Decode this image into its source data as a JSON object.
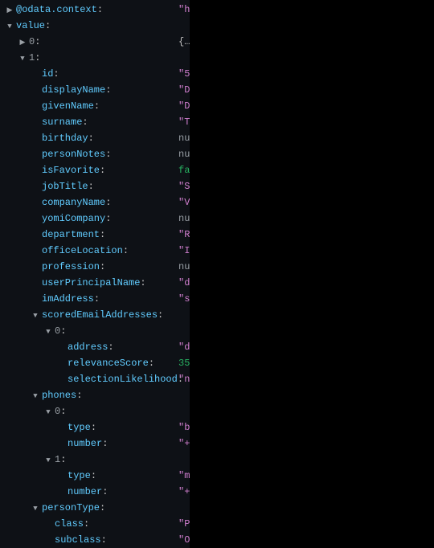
{
  "rows": [
    {
      "indent": 0,
      "twist": "right",
      "key": "@odata.context",
      "keyStyle": "key",
      "valText": "\"h",
      "valStyle": "val-string"
    },
    {
      "indent": 0,
      "twist": "down",
      "key": "value",
      "keyStyle": "key",
      "valText": "",
      "valStyle": ""
    },
    {
      "indent": 1,
      "twist": "right",
      "key": "0",
      "keyStyle": "key-gray",
      "valText": "{…",
      "valStyle": "val-obj"
    },
    {
      "indent": 1,
      "twist": "down",
      "key": "1",
      "keyStyle": "key-gray",
      "valText": "",
      "valStyle": ""
    },
    {
      "indent": 2,
      "twist": "",
      "key": "id",
      "keyStyle": "key",
      "valText": "\"5",
      "valStyle": "val-string"
    },
    {
      "indent": 2,
      "twist": "",
      "key": "displayName",
      "keyStyle": "key",
      "valText": "\"D",
      "valStyle": "val-string"
    },
    {
      "indent": 2,
      "twist": "",
      "key": "givenName",
      "keyStyle": "key",
      "valText": "\"D",
      "valStyle": "val-string"
    },
    {
      "indent": 2,
      "twist": "",
      "key": "surname",
      "keyStyle": "key",
      "valText": "\"T",
      "valStyle": "val-string"
    },
    {
      "indent": 2,
      "twist": "",
      "key": "birthday",
      "keyStyle": "key",
      "valText": "nu",
      "valStyle": "val-null"
    },
    {
      "indent": 2,
      "twist": "",
      "key": "personNotes",
      "keyStyle": "key",
      "valText": "nu",
      "valStyle": "val-null"
    },
    {
      "indent": 2,
      "twist": "",
      "key": "isFavorite",
      "keyStyle": "key",
      "valText": "fa",
      "valStyle": "val-false"
    },
    {
      "indent": 2,
      "twist": "",
      "key": "jobTitle",
      "keyStyle": "key",
      "valText": "\"S",
      "valStyle": "val-string"
    },
    {
      "indent": 2,
      "twist": "",
      "key": "companyName",
      "keyStyle": "key",
      "valText": "\"V",
      "valStyle": "val-string"
    },
    {
      "indent": 2,
      "twist": "",
      "key": "yomiCompany",
      "keyStyle": "key",
      "valText": "nu",
      "valStyle": "val-null"
    },
    {
      "indent": 2,
      "twist": "",
      "key": "department",
      "keyStyle": "key",
      "valText": "\"R",
      "valStyle": "val-string"
    },
    {
      "indent": 2,
      "twist": "",
      "key": "officeLocation",
      "keyStyle": "key",
      "valText": "\"I",
      "valStyle": "val-string"
    },
    {
      "indent": 2,
      "twist": "",
      "key": "profession",
      "keyStyle": "key",
      "valText": "nu",
      "valStyle": "val-null"
    },
    {
      "indent": 2,
      "twist": "",
      "key": "userPrincipalName",
      "keyStyle": "key",
      "valText": "\"d",
      "valStyle": "val-string"
    },
    {
      "indent": 2,
      "twist": "",
      "key": "imAddress",
      "keyStyle": "key",
      "valText": "\"s",
      "valStyle": "val-string"
    },
    {
      "indent": 2,
      "twist": "down",
      "key": "scoredEmailAddresses",
      "keyStyle": "key",
      "valText": "",
      "valStyle": ""
    },
    {
      "indent": 3,
      "twist": "down",
      "key": "0",
      "keyStyle": "key-gray",
      "valText": "",
      "valStyle": ""
    },
    {
      "indent": 4,
      "twist": "",
      "key": "address",
      "keyStyle": "key",
      "valText": "\"d",
      "valStyle": "val-string"
    },
    {
      "indent": 4,
      "twist": "",
      "key": "relevanceScore",
      "keyStyle": "key",
      "valText": "35",
      "valStyle": "val-num"
    },
    {
      "indent": 4,
      "twist": "",
      "key": "selectionLikelihood",
      "keyStyle": "key",
      "valText": "\"n",
      "valStyle": "val-string"
    },
    {
      "indent": 2,
      "twist": "down",
      "key": "phones",
      "keyStyle": "key",
      "valText": "",
      "valStyle": ""
    },
    {
      "indent": 3,
      "twist": "down",
      "key": "0",
      "keyStyle": "key-gray",
      "valText": "",
      "valStyle": ""
    },
    {
      "indent": 4,
      "twist": "",
      "key": "type",
      "keyStyle": "key",
      "valText": "\"b",
      "valStyle": "val-string"
    },
    {
      "indent": 4,
      "twist": "",
      "key": "number",
      "keyStyle": "key",
      "valText": "\"+",
      "valStyle": "val-string"
    },
    {
      "indent": 3,
      "twist": "down",
      "key": "1",
      "keyStyle": "key-gray",
      "valText": "",
      "valStyle": ""
    },
    {
      "indent": 4,
      "twist": "",
      "key": "type",
      "keyStyle": "key",
      "valText": "\"m",
      "valStyle": "val-string"
    },
    {
      "indent": 4,
      "twist": "",
      "key": "number",
      "keyStyle": "key",
      "valText": "\"+",
      "valStyle": "val-string"
    },
    {
      "indent": 2,
      "twist": "down",
      "key": "personType",
      "keyStyle": "key",
      "valText": "",
      "valStyle": ""
    },
    {
      "indent": 3,
      "twist": "",
      "key": "class",
      "keyStyle": "key",
      "valText": "\"P",
      "valStyle": "val-string"
    },
    {
      "indent": 3,
      "twist": "",
      "key": "subclass",
      "keyStyle": "key",
      "valText": "\"O",
      "valStyle": "val-string"
    }
  ],
  "glyphs": {
    "down": "▼",
    "right": "▶"
  },
  "colonText": ":",
  "baseIndentPx": 6,
  "stepIndentPx": 16
}
